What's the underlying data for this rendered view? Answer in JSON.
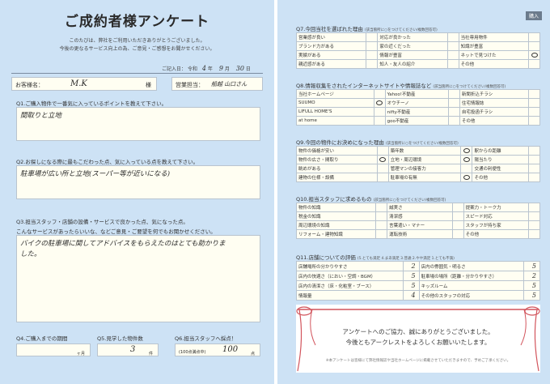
{
  "left": {
    "title": "ご成約者様アンケート",
    "tag": "購入",
    "intro": [
      "このたびは、弊社をご利用いただきありがとうございました。",
      "今後の更なるサービス向上の為、ご意見・ご感想をお聞かせください。"
    ],
    "date": {
      "label": "ご記入日：",
      "era": "令和",
      "year": "4",
      "year_unit": "年",
      "month": "9",
      "month_unit": "月",
      "day": "30",
      "day_unit": "日"
    },
    "customer": {
      "label": "お客様名：",
      "value": "M.K",
      "suffix": "様"
    },
    "staff": {
      "label": "営業担当：",
      "value": "船越 山口さん"
    },
    "q1": {
      "label": "Q1.ご購入物件で一番気に入っているポイントを教えて下さい。",
      "answer": "間取りと立地"
    },
    "q2": {
      "label": "Q2.お探しになる際に最もこだわった点、気に入っている点を教えて下さい。",
      "answer": "駐車場が広い所と立地(スーパー等が近いになる)"
    },
    "q3": {
      "label": "Q3.担当スタッフ・店舗の設備・サービスで良かった点、気になった点。",
      "sub1": "こんなサービスがあったらいいな、などご意見・ご要望を何でもお聞かせください。",
      "answer_lines": [
        "バイクの駐車場に関してアドバイスをもらえたのはとても助かりま",
        "した。"
      ]
    },
    "q4": {
      "label": "Q4.ご購入までの期間",
      "value": "",
      "unit": "ヶ月"
    },
    "q5": {
      "label": "Q5.見学した物件数",
      "value": "3",
      "unit": "件"
    },
    "q6": {
      "label": "Q6.担当スタッフへ採点！",
      "sub": "(100点満点中)",
      "value": "100",
      "unit": "点"
    }
  },
  "right": {
    "q7": {
      "title": "Q7.今回当社を選ばれた理由",
      "note": "(該当箇所に○をつけてください/複数回答可)",
      "rows": [
        [
          {
            "t": "営業感が良い",
            "m": ""
          },
          {
            "t": "対応が良かった",
            "m": ""
          },
          {
            "t": "当社専用物件",
            "m": ""
          }
        ],
        [
          {
            "t": "ブランド力がある",
            "m": ""
          },
          {
            "t": "家の近くだった",
            "m": ""
          },
          {
            "t": "知識が豊富",
            "m": ""
          }
        ],
        [
          {
            "t": "実績がある",
            "m": ""
          },
          {
            "t": "情報が豊富",
            "m": ""
          },
          {
            "t": "ネットで見つけた",
            "m": "○"
          }
        ],
        [
          {
            "t": "親近感がある",
            "m": ""
          },
          {
            "t": "知人・友人の紹介",
            "m": ""
          },
          {
            "t": "その他",
            "m": ""
          }
        ]
      ]
    },
    "q8": {
      "title": "Q8.情報収集をされたインターネットサイトや情報誌など",
      "note": "(該当箇所に○をつけてください/複数回答可)",
      "rows": [
        [
          {
            "t": "当社ホームページ",
            "m": ""
          },
          {
            "t": "Yahoo!不動産",
            "m": ""
          },
          {
            "t": "新聞折込チラシ",
            "m": ""
          }
        ],
        [
          {
            "t": "SUUMO",
            "m": "○"
          },
          {
            "t": "オウチーノ",
            "m": ""
          },
          {
            "t": "住宅情報誌",
            "m": ""
          }
        ],
        [
          {
            "t": "LIFULL HOME'S",
            "m": ""
          },
          {
            "t": "nifty不動産",
            "m": ""
          },
          {
            "t": "自宅投函チラシ",
            "m": ""
          }
        ],
        [
          {
            "t": "at home",
            "m": ""
          },
          {
            "t": "goo不動産",
            "m": ""
          },
          {
            "t": "その他",
            "m": ""
          }
        ]
      ]
    },
    "q9": {
      "title": "Q9.今回の物件にお決めになった理由",
      "note": "(該当箇所に○をつけてください/複数回答可)",
      "rows": [
        [
          {
            "t": "物件の価格が安い",
            "m": ""
          },
          {
            "t": "築年数",
            "m": "○"
          },
          {
            "t": "駅からの距離",
            "m": ""
          }
        ],
        [
          {
            "t": "物件の広さ・間取り",
            "m": "○"
          },
          {
            "t": "立地・周辺環境",
            "m": "○"
          },
          {
            "t": "陽当たり",
            "m": ""
          }
        ],
        [
          {
            "t": "眺めがある",
            "m": ""
          },
          {
            "t": "管理マンの接客力",
            "m": ""
          },
          {
            "t": "交通の利便性",
            "m": ""
          }
        ],
        [
          {
            "t": "建物の仕様・設備",
            "m": ""
          },
          {
            "t": "駐車場の有無",
            "m": "○"
          },
          {
            "t": "その他",
            "m": ""
          }
        ]
      ]
    },
    "q10": {
      "title": "Q10.担当スタッフに求めるもの",
      "note": "(該当箇所に○をつけてください/複数回答可)",
      "rows": [
        [
          {
            "t": "物件の知識",
            "m": ""
          },
          {
            "t": "誠実さ",
            "m": ""
          },
          {
            "t": "提案力・トーク力",
            "m": ""
          }
        ],
        [
          {
            "t": "税金の知識",
            "m": ""
          },
          {
            "t": "清潔感",
            "m": ""
          },
          {
            "t": "スピード対応",
            "m": ""
          }
        ],
        [
          {
            "t": "周辺環境の知識",
            "m": ""
          },
          {
            "t": "言葉遣い・マナー",
            "m": ""
          },
          {
            "t": "スタッフが持ち家",
            "m": ""
          }
        ],
        [
          {
            "t": "リフォーム・建物知識",
            "m": ""
          },
          {
            "t": "運転技術",
            "m": ""
          },
          {
            "t": "その他",
            "m": ""
          }
        ]
      ]
    },
    "q11": {
      "title": "Q11.店舗についての評価",
      "note": "(5.とても満足 4.まあ満足 3.普通 2.やや満足 1.とても不満)",
      "rows": [
        [
          {
            "t": "店舗場所の分かりやすさ",
            "s": "2"
          },
          {
            "t": "店内の雰囲気・明るさ",
            "s": "5"
          }
        ],
        [
          {
            "t": "店内の快適さ（におい・空調・BGM）",
            "s": "5"
          },
          {
            "t": "駐車場の場所（距離・分かりやすさ）",
            "s": "2"
          }
        ],
        [
          {
            "t": "店内の清潔さ（床・化粧室・ブース）",
            "s": "5"
          },
          {
            "t": "キッズルーム",
            "s": "5"
          }
        ],
        [
          {
            "t": "情報量",
            "s": "4"
          },
          {
            "t": "その他のスタッフの対応",
            "s": "5"
          }
        ]
      ]
    },
    "thanks": {
      "line1": "アンケートへのご協力、誠にありがとうございました。",
      "line2": "今後ともアークレストをよろしくお願いいたします。",
      "note": "※本アンケートは皆様にて弊社情報誌や当社ホームページに掲載させていただきますので、予めご了承ください。"
    }
  },
  "colors": {
    "background_blue": "#cde2f5",
    "field_cream": "#fffef2",
    "ribbon_red": "#d2545c"
  }
}
